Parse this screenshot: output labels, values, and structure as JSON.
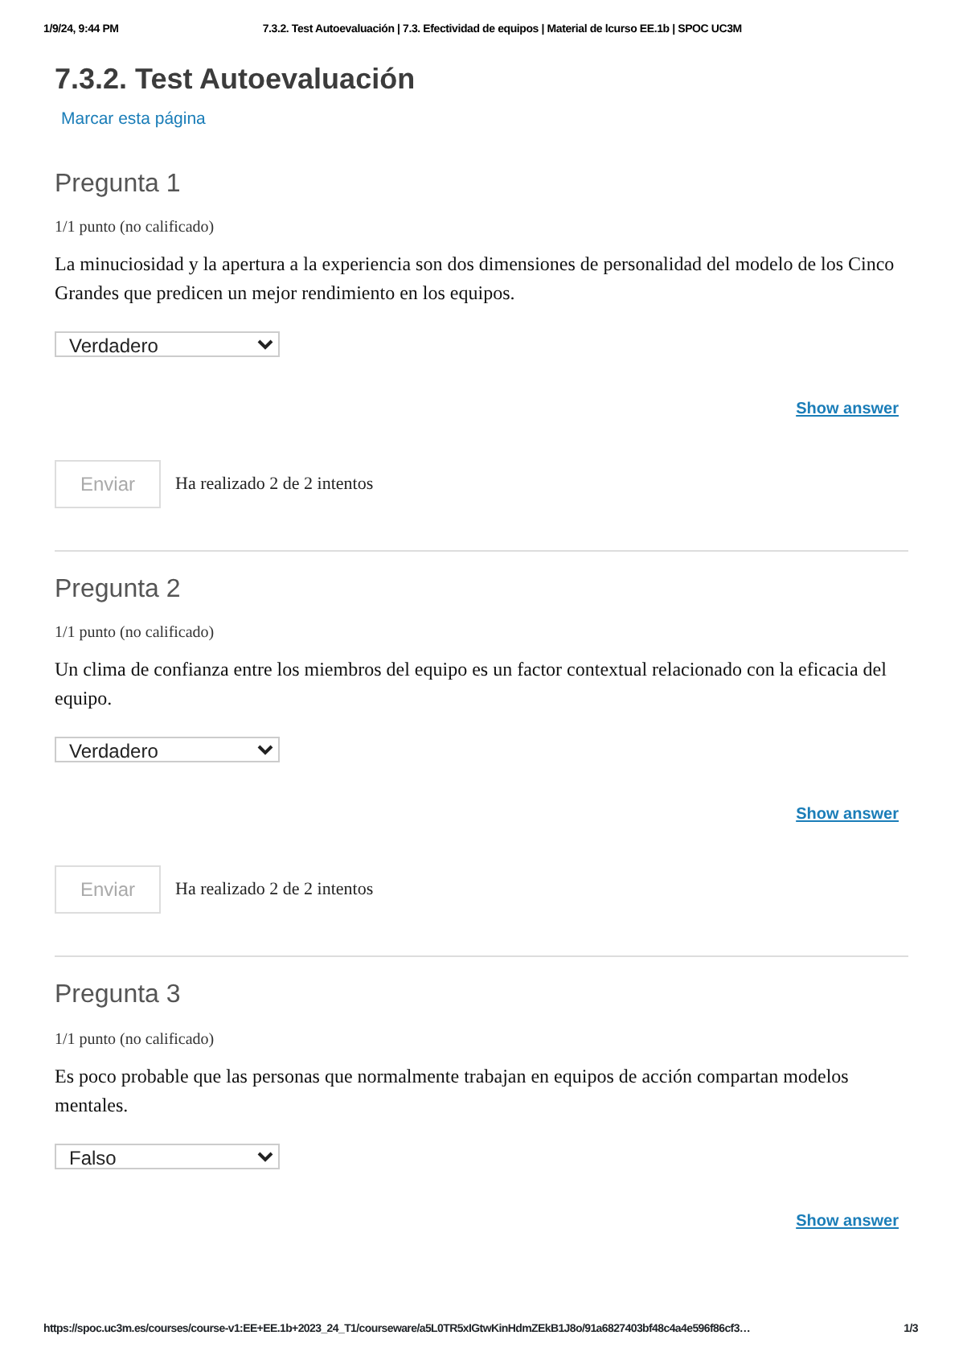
{
  "print_header": {
    "date": "1/9/24, 9:44 PM",
    "title": "7.3.2. Test Autoevaluación | 7.3. Efectividad de equipos | Material de lcurso EE.1b | SPOC UC3M"
  },
  "page_title": "7.3.2. Test Autoevaluación",
  "bookmark_link": "Marcar esta página",
  "questions": [
    {
      "title": "Pregunta 1",
      "points": "1/1 punto (no calificado)",
      "text": "La minuciosidad y la apertura a la experiencia son dos dimensiones de personalidad del modelo de los Cinco Grandes que predicen un mejor rendimiento en los equipos.",
      "answer": "Verdadero",
      "show_answer": "Show answer",
      "submit": {
        "label": "Enviar",
        "disabled": true
      },
      "attempts": "Ha realizado 2 de 2 intentos"
    },
    {
      "title": "Pregunta 2",
      "points": "1/1 punto (no calificado)",
      "text": "Un clima de confianza entre los miembros del equipo es un factor contextual relacionado con la eficacia del equipo.",
      "answer": "Verdadero",
      "show_answer": "Show answer",
      "submit": {
        "label": "Enviar",
        "disabled": true
      },
      "attempts": "Ha realizado 2 de 2 intentos"
    },
    {
      "title": "Pregunta 3",
      "points": "1/1 punto (no calificado)",
      "text": "Es poco probable que las personas que normalmente trabajan en equipos de acción compartan modelos mentales.",
      "answer": "Falso",
      "show_answer": "Show answer"
    }
  ],
  "print_footer": {
    "url": "https://spoc.uc3m.es/courses/course-v1:EE+EE.1b+2023_24_T1/courseware/a5L0TR5xIGtwKinHdmZEkB1J8o/91a6827403bf48c4a4e596f86cf3…",
    "page": "1/3"
  }
}
